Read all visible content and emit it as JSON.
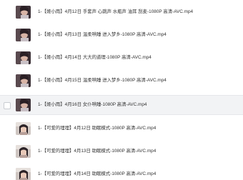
{
  "files": [
    {
      "name": "1-【姬小雨】4月12日 手套声 心跳声 水瓶声 油耳 刮麦-1080P 高清-AVC.mp4",
      "thumbnail": "video-thumbnail-icon",
      "selected": false
    },
    {
      "name": "1-【姬小雨】4月13日 温柔哄睡 进入梦乡-1080P 高清-AVC.mp4",
      "thumbnail": "video-thumbnail-icon",
      "selected": false
    },
    {
      "name": "1-【姬小雨】4月14日 大大的道理-1080P 高清-AVC.mp4",
      "thumbnail": "video-thumbnail-icon",
      "selected": false
    },
    {
      "name": "1-【姬小雨】4月15日 温柔哄睡 进入梦乡-1080P 高清-AVC.mp4",
      "thumbnail": "video-thumbnail-icon",
      "selected": false
    },
    {
      "name": "1-【姬小雨】4月16日 女仆哄睡-1080P 高清-AVC.mp4",
      "thumbnail": "video-thumbnail-icon",
      "selected": true
    },
    {
      "name": "1-【可爱的埋埋】4月12日 助眠模式-1080P 高清-AVC.mp4",
      "thumbnail": "video-thumbnail-icon",
      "selected": false
    },
    {
      "name": "1-【可爱的埋埋】4月13日 助眠模式-1080P 高清-AVC.mp4",
      "thumbnail": "video-thumbnail-icon",
      "selected": false
    },
    {
      "name": "1-【可爱的埋埋】4月14日 助眠模式-1080P 高清-AVC.mp4",
      "thumbnail": "video-thumbnail-icon",
      "selected": false
    }
  ]
}
